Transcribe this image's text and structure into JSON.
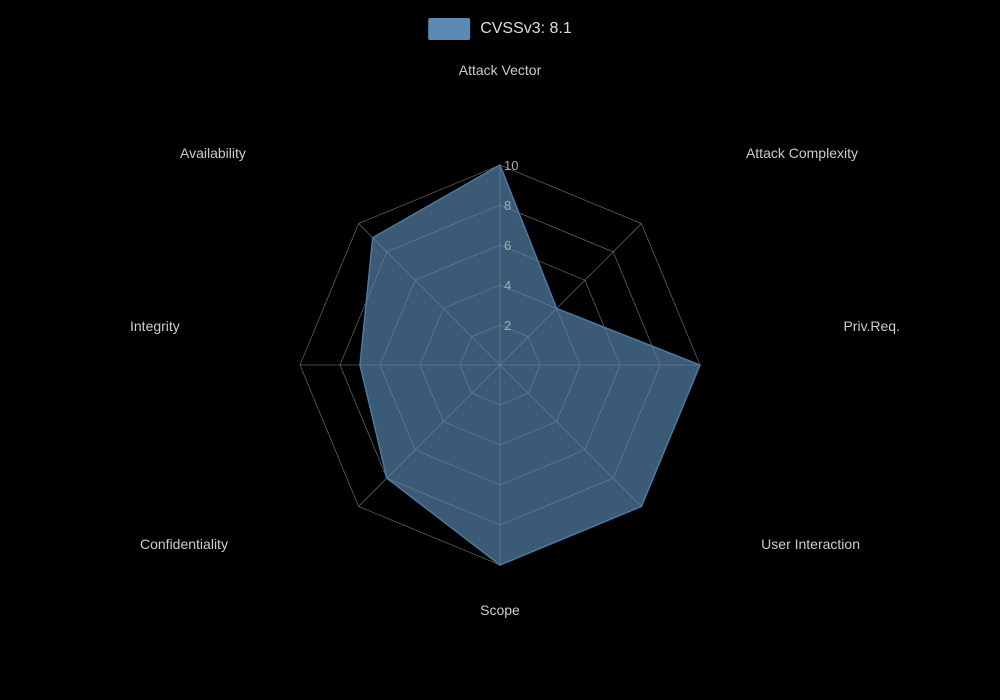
{
  "chart": {
    "title": "CVSSv3: 8.1",
    "legend_color": "#5b8ab5",
    "axes": [
      {
        "label": "Attack Vector",
        "value": 10,
        "angle": -90
      },
      {
        "label": "Attack Complexity",
        "value": 4,
        "angle": -38.57
      },
      {
        "label": "Priv.Req.",
        "value": 10,
        "angle": 12.86
      },
      {
        "label": "User Interaction",
        "value": 10,
        "angle": 64.29
      },
      {
        "label": "Scope",
        "value": 10,
        "angle": 115.71
      },
      {
        "label": "Confidentiality",
        "value": 8,
        "angle": 167.14
      },
      {
        "label": "Integrity",
        "value": 7,
        "angle": 218.57
      },
      {
        "label": "Availability",
        "value": 9,
        "angle": 270
      },
      {
        "label": "Attack Vector",
        "value": 10,
        "angle": -90
      }
    ],
    "ring_labels": [
      "2",
      "4",
      "6",
      "8",
      "10"
    ],
    "max_value": 10
  }
}
